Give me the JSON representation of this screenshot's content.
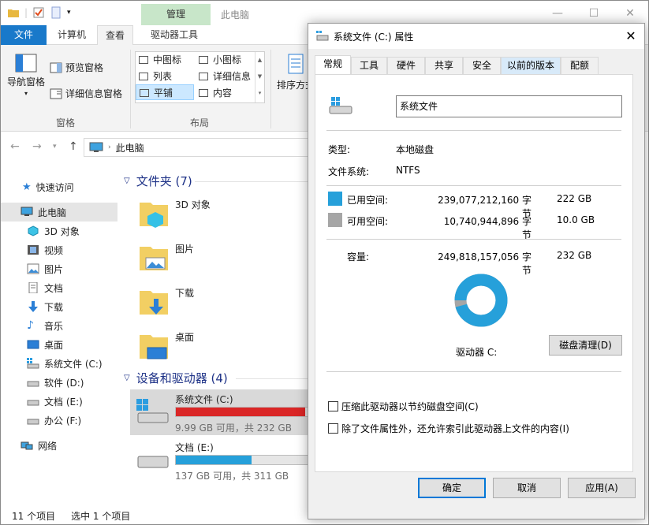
{
  "explorer": {
    "window_title": "此电脑",
    "context_group": "管理",
    "tabs": [
      "文件",
      "计算机",
      "查看",
      "驱动器工具"
    ],
    "ribbon": {
      "nav_pane": "导航窗格",
      "preview_pane": "预览窗格",
      "details_pane": "详细信息窗格",
      "pane_group": "窗格",
      "layout_items": [
        "中图标",
        "小图标",
        "列表",
        "详细信息",
        "平铺",
        "内容"
      ],
      "layout_group": "布局",
      "sort": "排序方式"
    },
    "address": "此电脑",
    "sidebar": [
      "快速访问",
      "此电脑",
      "3D 对象",
      "视频",
      "图片",
      "文档",
      "下载",
      "音乐",
      "桌面",
      "系统文件 (C:)",
      "软件 (D:)",
      "文档 (E:)",
      "办公 (F:)",
      "网络"
    ],
    "folders_header": "文件夹 (7)",
    "folders": [
      "3D 对象",
      "图片",
      "下载",
      "桌面"
    ],
    "drives_header": "设备和驱动器 (4)",
    "drives": [
      {
        "name": "系统文件 (C:)",
        "info": "9.99 GB 可用，共 232 GB",
        "used_fraction": 0.957,
        "color": "#da2626"
      },
      {
        "name": "文档 (E:)",
        "info": "137 GB 可用，共 311 GB",
        "used_fraction": 0.56,
        "color": "#26a0da"
      }
    ],
    "status_items": "11 个项目",
    "status_selected": "选中 1 个项目"
  },
  "dialog": {
    "title": "系统文件 (C:) 属性",
    "tabs": [
      "常规",
      "工具",
      "硬件",
      "共享",
      "安全",
      "以前的版本",
      "配额"
    ],
    "name_value": "系统文件",
    "type_label": "类型:",
    "type_value": "本地磁盘",
    "fs_label": "文件系统:",
    "fs_value": "NTFS",
    "used_label": "已用空间:",
    "used_bytes": "239,077,212,160 字节",
    "used_gb": "222 GB",
    "free_label": "可用空间:",
    "free_bytes": "10,740,944,896 字节",
    "free_gb": "10.0 GB",
    "cap_label": "容量:",
    "cap_bytes": "249,818,157,056 字节",
    "cap_gb": "232 GB",
    "used_fraction": 0.957,
    "used_color": "#26a0da",
    "free_color": "#a6a6a6",
    "drive_letter": "驱动器 C:",
    "cleanup_btn": "磁盘清理(D)",
    "compress_label": "压缩此驱动器以节约磁盘空间(C)",
    "index_label": "除了文件属性外，还允许索引此驱动器上文件的内容(I)",
    "ok": "确定",
    "cancel": "取消",
    "apply": "应用(A)"
  }
}
